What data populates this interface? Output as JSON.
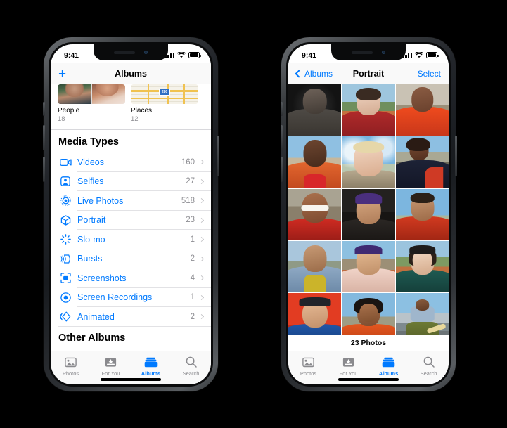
{
  "accent_blue": "#007AFF",
  "status_bar": {
    "time": "9:41",
    "signal_icon": "cellular-bars-icon",
    "wifi_icon": "wifi-icon",
    "battery_icon": "battery-icon"
  },
  "left_phone": {
    "nav": {
      "add_icon": "plus-icon",
      "title": "Albums"
    },
    "top_albums": [
      {
        "name": "People",
        "count": "18",
        "thumb": "people-faces-thumbnail"
      },
      {
        "name": "Places",
        "count": "12",
        "thumb": "map-thumbnail",
        "map_shield": "280"
      }
    ],
    "media_types": {
      "section_title": "Media Types",
      "rows": [
        {
          "icon": "video-camera-icon",
          "label": "Videos",
          "count": "160"
        },
        {
          "icon": "selfie-portrait-icon",
          "label": "Selfies",
          "count": "27"
        },
        {
          "icon": "live-photo-icon",
          "label": "Live Photos",
          "count": "518"
        },
        {
          "icon": "portrait-cube-icon",
          "label": "Portrait",
          "count": "23"
        },
        {
          "icon": "slo-mo-icon",
          "label": "Slo-mo",
          "count": "1"
        },
        {
          "icon": "bursts-stack-icon",
          "label": "Bursts",
          "count": "2"
        },
        {
          "icon": "screenshot-frame-icon",
          "label": "Screenshots",
          "count": "4"
        },
        {
          "icon": "screen-record-icon",
          "label": "Screen Recordings",
          "count": "1"
        },
        {
          "icon": "animated-gif-icon",
          "label": "Animated",
          "count": "2"
        }
      ]
    },
    "other_section_title": "Other Albums"
  },
  "right_phone": {
    "nav": {
      "back_icon": "chevron-left-icon",
      "back_label": "Albums",
      "title": "Portrait",
      "action_label": "Select"
    },
    "footer_count": "23 Photos",
    "grid": {
      "columns": 3,
      "photos": [
        {
          "name": "portrait-1",
          "desc": "man in trench coat, black and white"
        },
        {
          "name": "portrait-2",
          "desc": "person in red jacket on track field"
        },
        {
          "name": "portrait-3",
          "desc": "person in orange hoodie"
        },
        {
          "name": "portrait-4",
          "desc": "man in orange jacket, blue sky"
        },
        {
          "name": "portrait-5",
          "desc": "blond man smiling, clouds"
        },
        {
          "name": "portrait-6",
          "desc": "woman in patterned top with red sleeve"
        },
        {
          "name": "portrait-7",
          "desc": "person with white sunglasses"
        },
        {
          "name": "portrait-8",
          "desc": "person in purple beanie"
        },
        {
          "name": "portrait-9",
          "desc": "person in red jacket looking up"
        },
        {
          "name": "portrait-10",
          "desc": "man in yellow shirt and blue jacket"
        },
        {
          "name": "portrait-11",
          "desc": "person in purple beanie, pink shirt"
        },
        {
          "name": "portrait-12",
          "desc": "woman in black beanie, green top"
        },
        {
          "name": "portrait-13",
          "desc": "man in flat cap and blue shirt, red wall"
        },
        {
          "name": "portrait-14",
          "desc": "person in orange tee, dark hair"
        },
        {
          "name": "portrait-15",
          "desc": "man seated holding shoe, harbor"
        }
      ]
    }
  },
  "tabbar": {
    "tabs": [
      {
        "icon": "photos-icon",
        "label": "Photos",
        "active": false
      },
      {
        "icon": "for-you-icon",
        "label": "For You",
        "active": false
      },
      {
        "icon": "albums-icon",
        "label": "Albums",
        "active": true
      },
      {
        "icon": "search-icon",
        "label": "Search",
        "active": false
      }
    ]
  }
}
